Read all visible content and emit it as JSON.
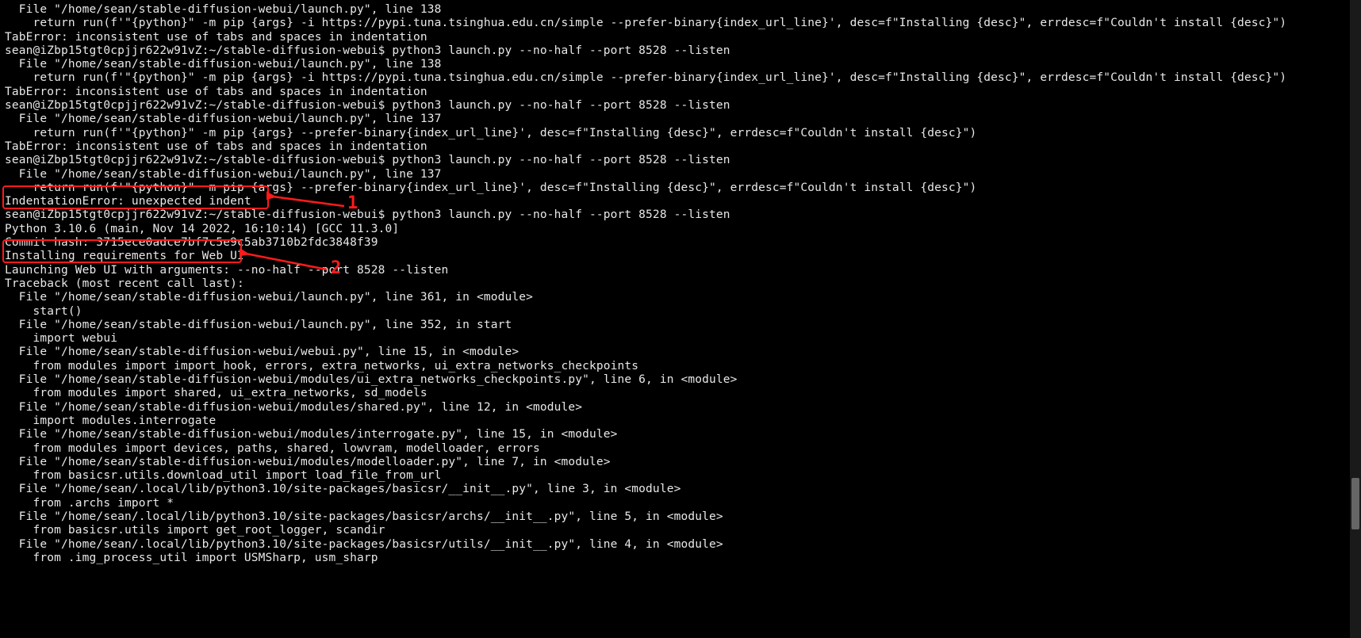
{
  "lines": [
    "  File \"/home/sean/stable-diffusion-webui/launch.py\", line 138",
    "    return run(f'\"{python}\" -m pip {args} -i https://pypi.tuna.tsinghua.edu.cn/simple --prefer-binary{index_url_line}', desc=f\"Installing {desc}\", errdesc=f\"Couldn't install {desc}\")",
    "TabError: inconsistent use of tabs and spaces in indentation",
    "sean@iZbp15tgt0cpjjr622w91vZ:~/stable-diffusion-webui$ python3 launch.py --no-half --port 8528 --listen",
    "  File \"/home/sean/stable-diffusion-webui/launch.py\", line 138",
    "    return run(f'\"{python}\" -m pip {args} -i https://pypi.tuna.tsinghua.edu.cn/simple --prefer-binary{index_url_line}', desc=f\"Installing {desc}\", errdesc=f\"Couldn't install {desc}\")",
    "TabError: inconsistent use of tabs and spaces in indentation",
    "sean@iZbp15tgt0cpjjr622w91vZ:~/stable-diffusion-webui$ python3 launch.py --no-half --port 8528 --listen",
    "  File \"/home/sean/stable-diffusion-webui/launch.py\", line 137",
    "    return run(f'\"{python}\" -m pip {args} --prefer-binary{index_url_line}', desc=f\"Installing {desc}\", errdesc=f\"Couldn't install {desc}\")",
    "TabError: inconsistent use of tabs and spaces in indentation",
    "sean@iZbp15tgt0cpjjr622w91vZ:~/stable-diffusion-webui$ python3 launch.py --no-half --port 8528 --listen",
    "  File \"/home/sean/stable-diffusion-webui/launch.py\", line 137",
    "    return run(f'\"{python}\"  m pip {args} --prefer-binary{index_url_line}', desc=f\"Installing {desc}\", errdesc=f\"Couldn't install {desc}\")",
    "IndentationError: unexpected indent",
    "sean@iZbp15tgt0cpjjr622w91vZ:~/stable-diffusion-webui$ python3 launch.py --no-half --port 8528 --listen",
    "Python 3.10.6 (main, Nov 14 2022, 16:10:14) [GCC 11.3.0]",
    "Commit hash: 3715ece0adce7bf7c5e9c5ab3710b2fdc3848f39",
    "Installing requirements for Web UI",
    "Launching Web UI with arguments: --no-half --port 8528 --listen",
    "Traceback (most recent call last):",
    "  File \"/home/sean/stable-diffusion-webui/launch.py\", line 361, in <module>",
    "    start()",
    "  File \"/home/sean/stable-diffusion-webui/launch.py\", line 352, in start",
    "    import webui",
    "  File \"/home/sean/stable-diffusion-webui/webui.py\", line 15, in <module>",
    "    from modules import import_hook, errors, extra_networks, ui_extra_networks_checkpoints",
    "  File \"/home/sean/stable-diffusion-webui/modules/ui_extra_networks_checkpoints.py\", line 6, in <module>",
    "    from modules import shared, ui_extra_networks, sd_models",
    "  File \"/home/sean/stable-diffusion-webui/modules/shared.py\", line 12, in <module>",
    "    import modules.interrogate",
    "  File \"/home/sean/stable-diffusion-webui/modules/interrogate.py\", line 15, in <module>",
    "    from modules import devices, paths, shared, lowvram, modelloader, errors",
    "  File \"/home/sean/stable-diffusion-webui/modules/modelloader.py\", line 7, in <module>",
    "    from basicsr.utils.download_util import load_file_from_url",
    "  File \"/home/sean/.local/lib/python3.10/site-packages/basicsr/__init__.py\", line 3, in <module>",
    "    from .archs import *",
    "  File \"/home/sean/.local/lib/python3.10/site-packages/basicsr/archs/__init__.py\", line 5, in <module>",
    "    from basicsr.utils import get_root_logger, scandir",
    "  File \"/home/sean/.local/lib/python3.10/site-packages/basicsr/utils/__init__.py\", line 4, in <module>",
    "    from .img_process_util import USMSharp, usm_sharp"
  ],
  "annotations": {
    "box1": {
      "note": "IndentationError: unexpected indent highlight"
    },
    "box2": {
      "note": "Installing requirements for Web UI highlight"
    },
    "num1": "1",
    "num2": "2"
  },
  "scrollbar": {
    "thumbTop": 603,
    "thumbHeight": 65
  }
}
